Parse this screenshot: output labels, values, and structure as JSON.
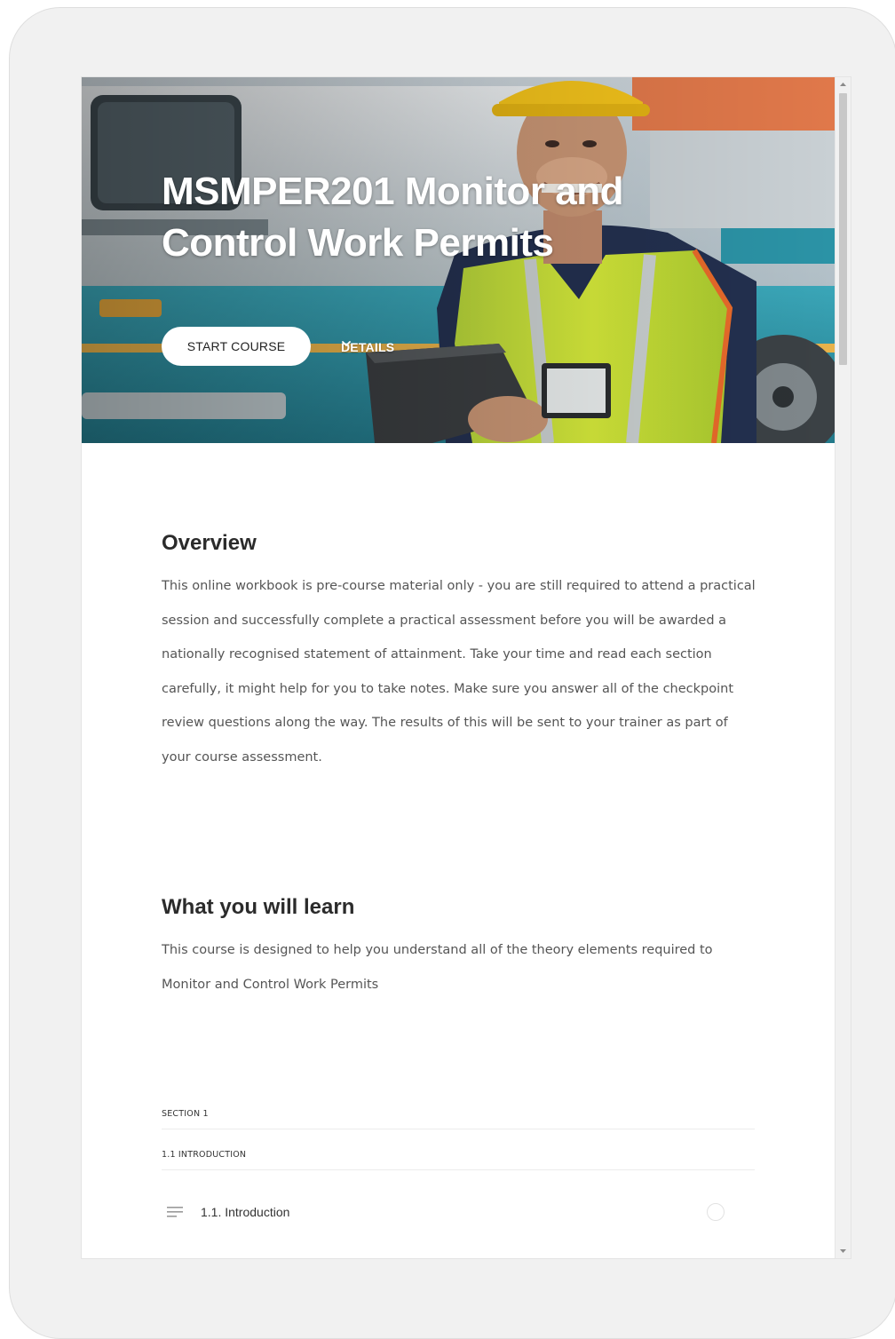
{
  "course": {
    "title": "MSMPER201 Monitor and Control Work Permits",
    "start_label": "START COURSE",
    "details_label": "DETAILS"
  },
  "overview": {
    "heading": "Overview",
    "text": "This online workbook is pre-course material only - you are still required to attend a practical session and successfully complete a practical assessment before you will be awarded a nationally recognised statement of attainment. Take your time and read each section carefully, it might help for you to take notes. Make sure you answer all of the checkpoint review questions along the way. The results of this will be sent to your trainer as part of your course assessment."
  },
  "learn": {
    "heading": "What you will learn",
    "text": "This course is designed to help you understand all of the theory elements required to Monitor and Control Work Permits"
  },
  "outline": {
    "section_label": "SECTION 1",
    "subsection_label": "1.1 INTRODUCTION",
    "lesson_label": "1.1. Introduction"
  },
  "icons": {
    "details": "chevron-down-icon",
    "lesson": "text-lines-icon",
    "status": "incomplete-circle-icon"
  },
  "colors": {
    "accent_button_bg": "#ffffff",
    "page_bg": "#f1f1f1"
  }
}
